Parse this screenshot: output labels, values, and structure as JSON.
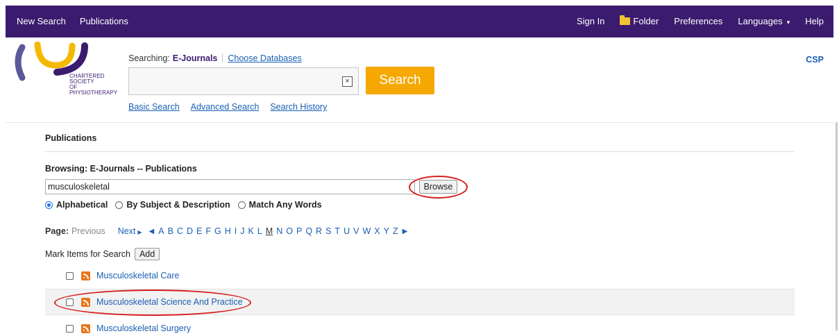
{
  "topnav": {
    "left": [
      "New Search",
      "Publications"
    ],
    "sign_in": "Sign In",
    "folder": "Folder",
    "preferences": "Preferences",
    "languages": "Languages",
    "help": "Help"
  },
  "logo": {
    "line1": "CHARTERED",
    "line2": "SOCIETY",
    "line3": "OF",
    "line4": "PHYSIOTHERAPY"
  },
  "search": {
    "searching_label": "Searching:",
    "database": "E-Journals",
    "choose_databases": "Choose Databases",
    "button": "Search",
    "links": [
      "Basic Search",
      "Advanced Search",
      "Search History"
    ],
    "input_value": "",
    "clear_glyph": "×"
  },
  "csp": "CSP",
  "publications": {
    "title": "Publications",
    "browsing_label": "Browsing:  E-Journals -- Publications",
    "browse_value": "musculoskeletal",
    "browse_button": "Browse",
    "radios": [
      {
        "label": "Alphabetical",
        "selected": true
      },
      {
        "label": "By Subject & Description",
        "selected": false
      },
      {
        "label": "Match Any Words",
        "selected": false
      }
    ],
    "page_label": "Page:",
    "prev": "Previous",
    "next": "Next",
    "letters": [
      "A",
      "B",
      "C",
      "D",
      "E",
      "F",
      "G",
      "H",
      "I",
      "J",
      "K",
      "L",
      "M",
      "N",
      "O",
      "P",
      "Q",
      "R",
      "S",
      "T",
      "U",
      "V",
      "W",
      "X",
      "Y",
      "Z"
    ],
    "current_letter": "M",
    "mark_label": "Mark Items for Search",
    "add_button": "Add",
    "results": [
      "Musculoskeletal Care",
      "Musculoskeletal Science And Practice",
      "Musculoskeletal Surgery"
    ]
  },
  "colors": {
    "nav_bg": "#3b1b6e",
    "search_button": "#f5a800",
    "link": "#1a5fb4",
    "annotation": "#d71d1d",
    "logo_yellow": "#f5b800"
  }
}
